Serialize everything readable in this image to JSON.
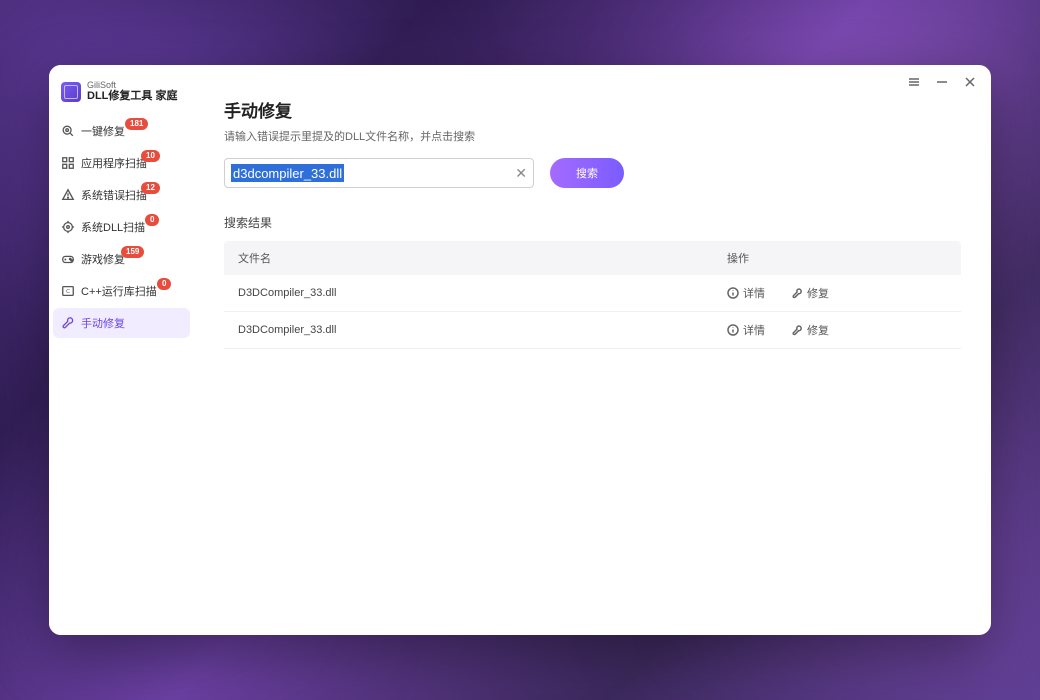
{
  "brand": "GiliSoft",
  "app_title": "DLL修复工具 家庭",
  "sidebar": {
    "items": [
      {
        "label": "一键修复",
        "badge": "181",
        "icon": "magnify"
      },
      {
        "label": "应用程序扫描",
        "badge": "10",
        "icon": "grid"
      },
      {
        "label": "系统错误扫描",
        "badge": "12",
        "icon": "warning"
      },
      {
        "label": "系统DLL扫描",
        "badge": "0",
        "icon": "target"
      },
      {
        "label": "游戏修复",
        "badge": "159",
        "icon": "gamepad"
      },
      {
        "label": "C++运行库扫描",
        "badge": "0",
        "icon": "cpp"
      },
      {
        "label": "手动修复",
        "badge": null,
        "icon": "wrench"
      }
    ]
  },
  "page": {
    "title": "手动修复",
    "subtitle": "请输入错误提示里提及的DLL文件名称，并点击搜索"
  },
  "search": {
    "value": "d3dcompiler_33.dll",
    "button": "搜索"
  },
  "results": {
    "label": "搜索结果",
    "headers": {
      "filename": "文件名",
      "actions": "操作"
    },
    "action_detail": "详情",
    "action_repair": "修复",
    "rows": [
      {
        "filename": "D3DCompiler_33.dll"
      },
      {
        "filename": "D3DCompiler_33.dll"
      }
    ]
  }
}
